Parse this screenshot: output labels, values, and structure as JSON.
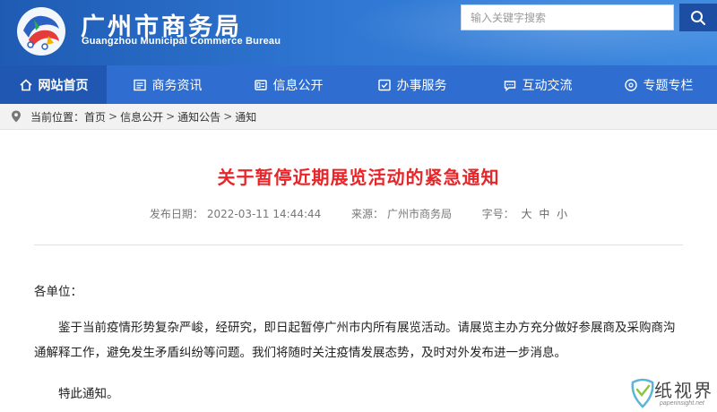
{
  "header": {
    "title_cn": "广州市商务局",
    "title_en": "Guangzhou Municipal Commerce Bureau",
    "search_placeholder": "输入关键字搜索"
  },
  "nav": {
    "items": [
      {
        "label": "网站首页",
        "icon": "home-icon",
        "active": true
      },
      {
        "label": "商务资讯",
        "icon": "news-icon",
        "active": false
      },
      {
        "label": "信息公开",
        "icon": "info-icon",
        "active": false
      },
      {
        "label": "办事服务",
        "icon": "service-icon",
        "active": false
      },
      {
        "label": "互动交流",
        "icon": "chat-icon",
        "active": false
      },
      {
        "label": "专题专栏",
        "icon": "topic-icon",
        "active": false
      }
    ]
  },
  "breadcrumb": {
    "prefix": "当前位置：",
    "items": [
      "首页",
      "信息公开",
      "通知公告",
      "通知"
    ],
    "separator": ">"
  },
  "article": {
    "title": "关于暂停近期展览活动的紧急通知",
    "meta": {
      "date_label": "发布日期：",
      "date": "2022-03-11 14:44:44",
      "source_label": "来源：",
      "source": "广州市商务局",
      "fontsize_label": "字号：",
      "sizes": [
        "大",
        "中",
        "小"
      ]
    },
    "salutation": "各单位：",
    "paragraph": "鉴于当前疫情形势复杂严峻，经研究，即日起暂停广州市内所有展览活动。请展览主办方充分做好参展商及采购商沟通解释工作，避免发生矛盾纠纷等问题。我们将随时关注疫情发展态势，及时对外发布进一步消息。",
    "closing": "特此通知。"
  },
  "watermark": {
    "text": "纸视界",
    "sub": "paperinsight.net"
  },
  "colors": {
    "header_blue": "#2e76d2",
    "nav_blue": "#2f6ed0",
    "nav_active": "#1f57b2",
    "title_red": "#e8262a"
  }
}
